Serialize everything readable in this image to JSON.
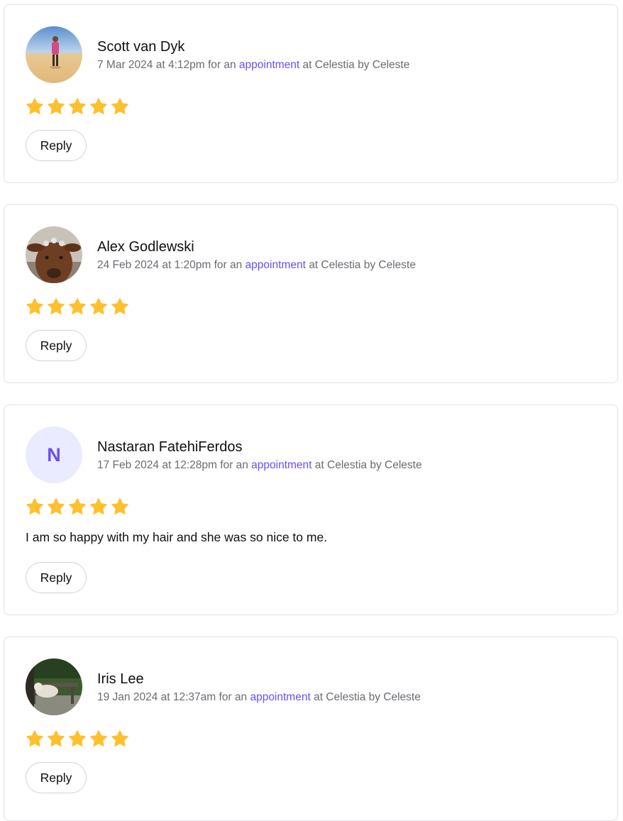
{
  "reviews": [
    {
      "name": "Scott van Dyk",
      "date": "7 Mar 2024 at 4:12pm",
      "for_text": "for an",
      "link_text": "appointment",
      "at_text": "at Celestia by Celeste",
      "rating": 5,
      "text": "",
      "reply_label": "Reply"
    },
    {
      "name": "Alex Godlewski",
      "date": "24 Feb 2024 at 1:20pm",
      "for_text": "for an",
      "link_text": "appointment",
      "at_text": "at Celestia by Celeste",
      "rating": 5,
      "text": "",
      "reply_label": "Reply"
    },
    {
      "name": "Nastaran FatehiFerdos",
      "initial": "N",
      "date": "17 Feb 2024 at 12:28pm",
      "for_text": "for an",
      "link_text": "appointment",
      "at_text": "at Celestia by Celeste",
      "rating": 5,
      "text": "I am so happy with my hair and she was so nice to me.",
      "reply_label": "Reply"
    },
    {
      "name": "Iris Lee",
      "date": "19 Jan 2024 at 12:37am",
      "for_text": "for an",
      "link_text": "appointment",
      "at_text": "at Celestia by Celeste",
      "rating": 5,
      "text": "",
      "reply_label": "Reply"
    }
  ],
  "colors": {
    "accent": "#6950f3",
    "star": "#ffc02d",
    "muted_text": "#6b6b73",
    "border": "#e3e3e6"
  }
}
